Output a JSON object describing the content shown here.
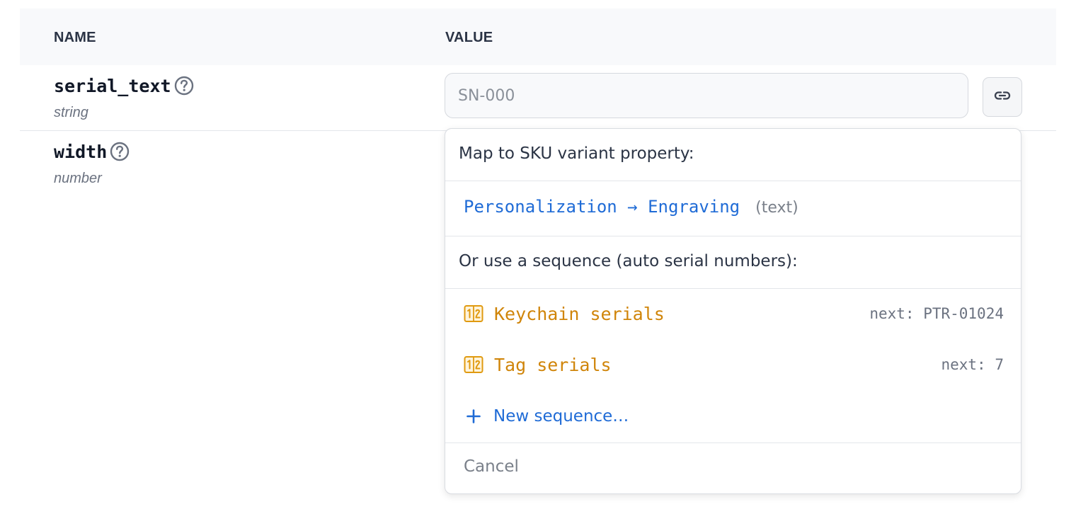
{
  "table": {
    "headers": {
      "name": "NAME",
      "value": "VALUE"
    },
    "rows": [
      {
        "name": "serial_text",
        "type": "string",
        "value": "",
        "placeholder": "SN-000"
      },
      {
        "name": "width",
        "type": "number"
      }
    ]
  },
  "dropdown": {
    "map_title": "Map to SKU variant property:",
    "mapping_option": {
      "path": "Personalization → Engraving",
      "type": "(text)"
    },
    "sequence_title": "Or use a sequence (auto serial numbers):",
    "sequences": [
      {
        "name": "Keychain serials",
        "next": "next: PTR-01024"
      },
      {
        "name": "Tag serials",
        "next": "next: 7"
      }
    ],
    "new_sequence_label": "New sequence…",
    "cancel_label": "Cancel"
  },
  "icons": {
    "help": "question-circle-icon",
    "link": "link-icon",
    "sequence": "numbered-sequence-icon",
    "plus": "plus-icon"
  },
  "colors": {
    "accent_blue": "#1f6bd6",
    "sequence_orange": "#d0850a",
    "header_bg": "#f8f9fb"
  }
}
